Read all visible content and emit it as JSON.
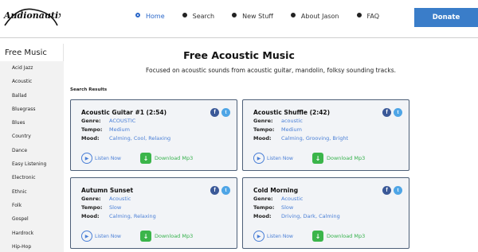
{
  "header": {
    "logo_text": "Audionautix",
    "nav": [
      {
        "label": "Home",
        "active": true
      },
      {
        "label": "Search",
        "active": false
      },
      {
        "label": "New Stuff",
        "active": false
      },
      {
        "label": "About Jason",
        "active": false
      },
      {
        "label": "FAQ",
        "active": false
      }
    ],
    "donate_label": "Donate",
    "accent_color": "#3a7dc9"
  },
  "sidebar": {
    "title": "Free Music",
    "items": [
      "Acid Jazz",
      "Acoustic",
      "Ballad",
      "Bluegrass",
      "Blues",
      "Country",
      "Dance",
      "Easy Listening",
      "Electronic",
      "Ethnic",
      "Folk",
      "Gospel",
      "Hardrock",
      "Hip-Hop"
    ]
  },
  "main": {
    "title": "Free Acoustic Music",
    "subtitle": "Focused on acoustic sounds from acoustic guitar, mandolin, folksy sounding tracks.",
    "results_label": "Search Results",
    "labels": {
      "genre": "Genre:",
      "tempo": "Tempo:",
      "mood": "Mood:",
      "listen": "Listen Now",
      "download": "Download Mp3"
    },
    "tracks": [
      {
        "title": "Acoustic Guitar #1 (2:54)",
        "genre": "ACOUSTIC",
        "tempo": "Medium",
        "mood": "Calming, Cool, Relaxing"
      },
      {
        "title": "Acoustic Shuffle (2:42)",
        "genre": "acoustic",
        "tempo": "Medium",
        "mood": "Calming, Grooving, Bright"
      },
      {
        "title": "Autumn Sunset",
        "genre": "Acoustic",
        "tempo": "Slow",
        "mood": "Calming, Relaxing"
      },
      {
        "title": "Cold Morning",
        "genre": "Acoustic",
        "tempo": "Slow",
        "mood": "Driving, Dark, Calming"
      }
    ]
  },
  "icons": {
    "home": "home-bullet-icon",
    "facebook": "facebook-icon",
    "twitter": "twitter-icon",
    "play": "play-icon",
    "download": "download-icon"
  }
}
